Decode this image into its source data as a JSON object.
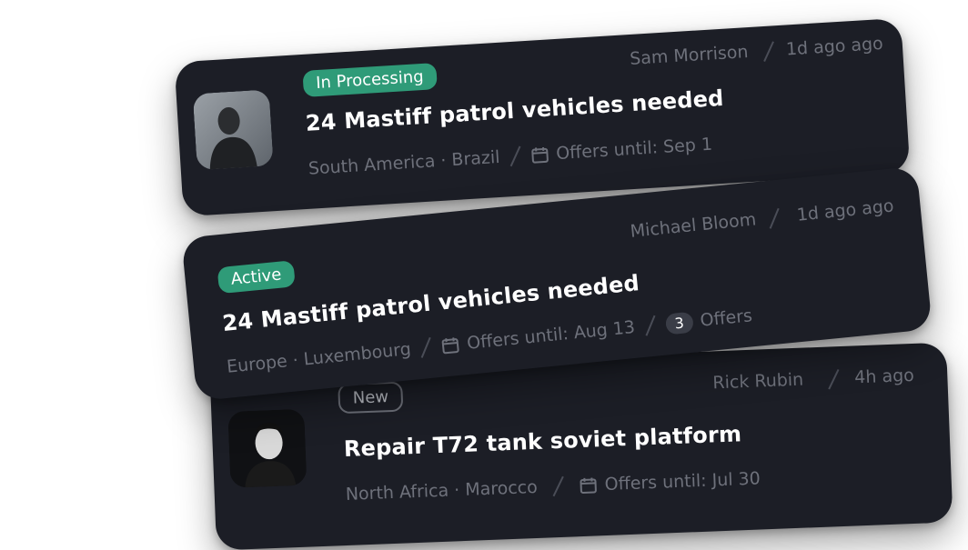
{
  "cards": [
    {
      "status": "In Processing",
      "author": "Sam Morrison",
      "time": "1d ago ago",
      "title": "24 Mastiff patrol vehicles needed",
      "location": "South America · Brazil",
      "offers_until": "Offers until: Sep 1"
    },
    {
      "status": "Active",
      "author": "Michael Bloom",
      "time": "1d ago ago",
      "title": "24 Mastiff patrol vehicles needed",
      "location": "Europe · Luxembourg",
      "offers_until": "Offers until: Aug 13",
      "offers_count": "3",
      "offers_label": "Offers"
    },
    {
      "status": "New",
      "author": "Rick Rubin",
      "time": "4h ago",
      "title": "Repair T72 tank soviet platform",
      "location": "North Africa · Marocco",
      "offers_until": "Offers until: Jul 30"
    }
  ],
  "colors": {
    "card_bg": "#1c1e26",
    "badge_green": "#2f9b78",
    "muted_text": "#6e717b"
  },
  "icons": {
    "calendar": "calendar-icon"
  }
}
